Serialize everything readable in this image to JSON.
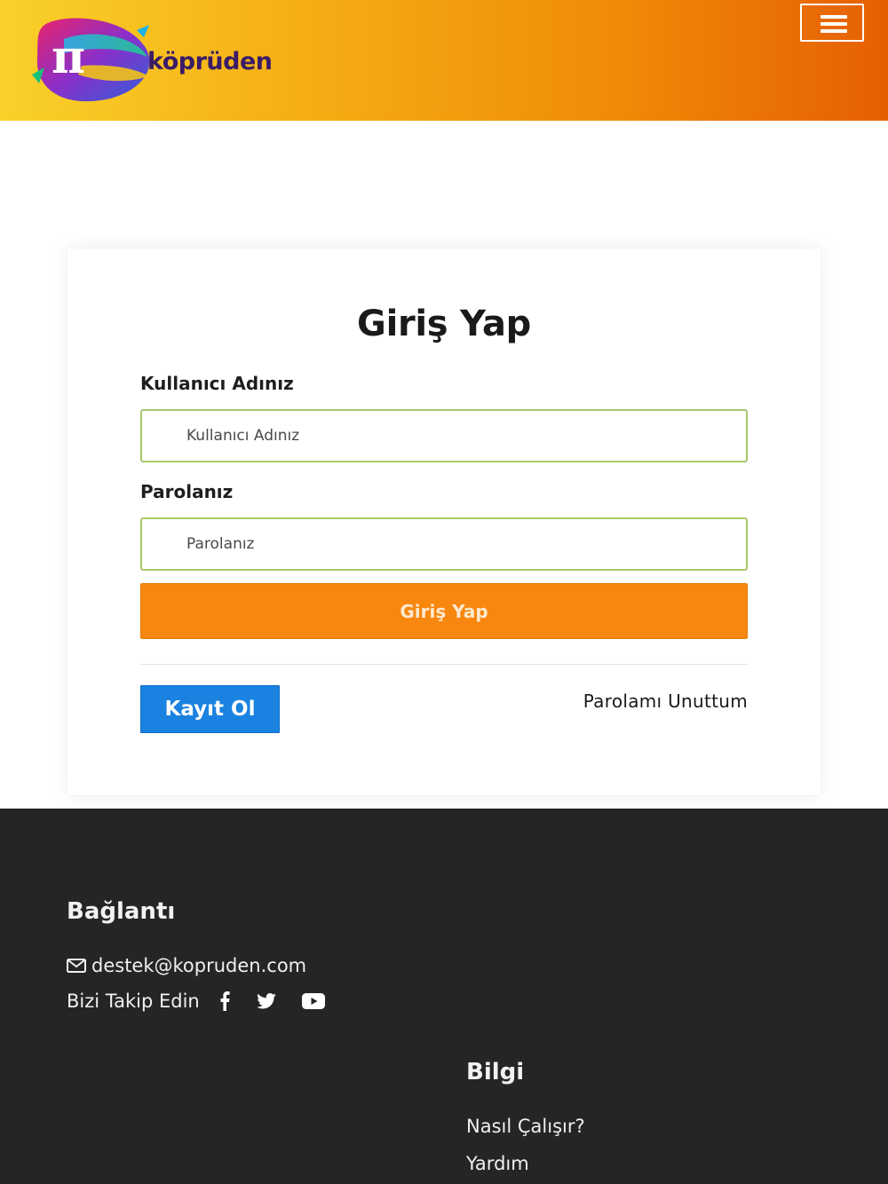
{
  "header": {
    "logo_text": "köprüden",
    "logo_symbol": "π",
    "menu_icon": "hamburger-icon",
    "gradient": [
      "#f9d12a",
      "#f08a08",
      "#e65f02"
    ]
  },
  "login": {
    "title": "Giriş Yap",
    "username_label": "Kullanıcı Adınız",
    "username_placeholder": "Kullanıcı Adınız",
    "password_label": "Parolanız",
    "password_placeholder": "Parolanız",
    "submit_label": "Giriş Yap",
    "register_label": "Kayıt Ol",
    "forgot_label": "Parolamı Unuttum"
  },
  "footer": {
    "connect_heading": "Bağlantı",
    "email": "destek@kopruden.com",
    "follow_text": "Bizi Takip Edin",
    "social_icons": [
      "facebook-icon",
      "twitter-icon",
      "youtube-icon"
    ],
    "info_heading": "Bilgi",
    "info_links": [
      "Nasıl Çalışır?",
      "Yardım"
    ]
  },
  "colors": {
    "accent_orange": "#f7870f",
    "primary_blue": "#1a82e0",
    "input_border": "#a8c86a",
    "footer_bg": "#252525"
  }
}
